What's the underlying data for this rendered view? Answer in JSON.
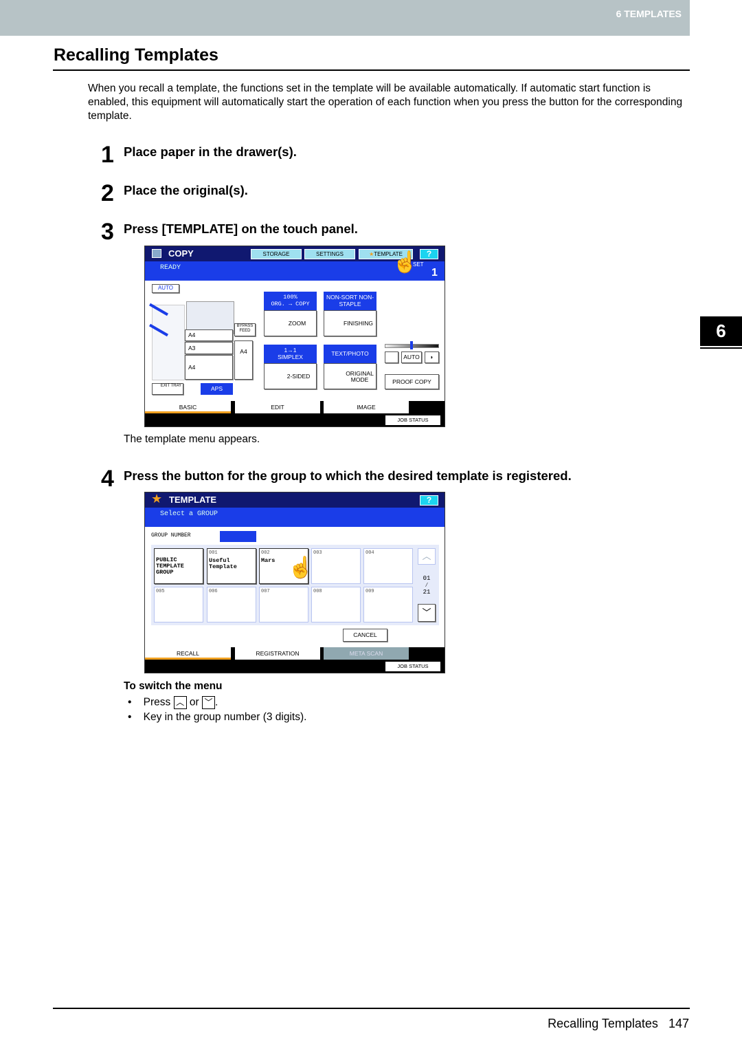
{
  "header": {
    "chapter": "6 TEMPLATES"
  },
  "side_tab": "6",
  "title": "Recalling Templates",
  "intro": "When you recall a template, the functions set in the template will be available automatically. If automatic start function is enabled, this equipment will automatically start the operation of each function when you press the button for the corresponding template.",
  "steps": [
    {
      "num": "1",
      "text": "Place paper in the drawer(s)."
    },
    {
      "num": "2",
      "text": "Place the original(s)."
    },
    {
      "num": "3",
      "text": "Press [TEMPLATE] on the touch panel."
    },
    {
      "num": "4",
      "text": "Press the button for the group to which the desired template is registered."
    }
  ],
  "copy_panel": {
    "title": "COPY",
    "status": "READY",
    "set_label": "SET",
    "set_count": "1",
    "top_buttons": [
      "STORAGE",
      "SETTINGS",
      "TEMPLATE",
      "?"
    ],
    "auto": "AUTO",
    "bypass": "BYPASS FEED",
    "trays": [
      "A4",
      "A3",
      "A4"
    ],
    "side_tray": "A4",
    "exit_tray": "EXIT TRAY",
    "aps": "APS",
    "zoom_label": "100%",
    "zoom_sub": "ORG. → COPY",
    "zoom_btn": "ZOOM",
    "finish_label": "NON-SORT NON-STAPLE",
    "finish_btn": "FINISHING",
    "sided_label": "1→1 SIMPLEX",
    "sided_btn": "2-SIDED",
    "mode_label": "TEXT/PHOTO",
    "mode_btn": "ORIGINAL MODE",
    "density_auto": "AUTO",
    "proof": "PROOF COPY",
    "tabs": [
      "BASIC",
      "EDIT",
      "IMAGE"
    ],
    "job_status": "JOB STATUS"
  },
  "note": "The template menu appears.",
  "template_panel": {
    "title": "TEMPLATE",
    "subtitle": "Select a GROUP",
    "help": "?",
    "group_number_label": "GROUP NUMBER",
    "cells": [
      {
        "num": "",
        "name": "PUBLIC TEMPLATE GROUP"
      },
      {
        "num": "001",
        "name": "Useful Template"
      },
      {
        "num": "002",
        "name": "Mars"
      },
      {
        "num": "003",
        "name": ""
      },
      {
        "num": "004",
        "name": ""
      },
      {
        "num": "005",
        "name": ""
      },
      {
        "num": "006",
        "name": ""
      },
      {
        "num": "007",
        "name": ""
      },
      {
        "num": "008",
        "name": ""
      },
      {
        "num": "009",
        "name": ""
      }
    ],
    "page_current": "01",
    "page_total": "21",
    "cancel": "CANCEL",
    "tabs": [
      "RECALL",
      "REGISTRATION",
      "META SCAN"
    ],
    "job_status": "JOB STATUS"
  },
  "switch": {
    "heading": "To switch the menu",
    "bullet1_pre": "Press",
    "bullet1_or": "or",
    "bullet1_post": ".",
    "bullet2": "Key in the group number (3 digits)."
  },
  "footer": {
    "title": "Recalling Templates",
    "page": "147"
  },
  "colors": {
    "panel_blue": "#1a3de8",
    "panel_navy": "#101870",
    "tab_orange": "#f0a020"
  }
}
